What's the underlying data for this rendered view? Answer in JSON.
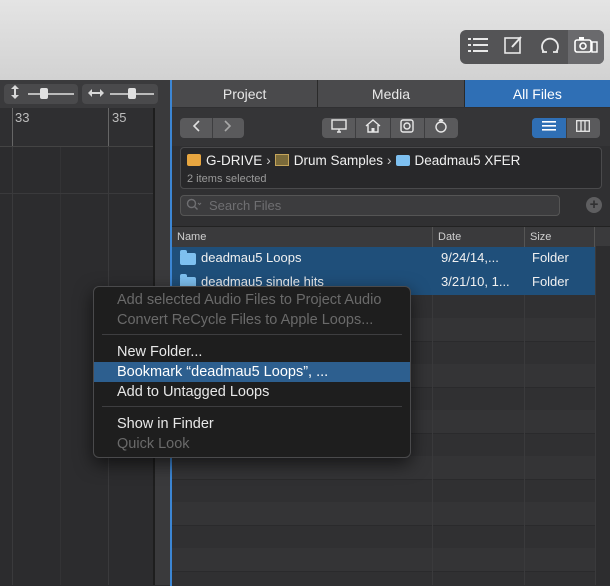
{
  "toolbar": {
    "tools": [
      "list-icon",
      "note-icon",
      "loop-icon",
      "browser-icon"
    ]
  },
  "ruler": {
    "marks": [
      "33",
      "35"
    ]
  },
  "browser": {
    "tabs": [
      {
        "label": "Project",
        "active": false
      },
      {
        "label": "Media",
        "active": false
      },
      {
        "label": "All Files",
        "active": true
      }
    ],
    "path": {
      "items": [
        {
          "label": "G-DRIVE",
          "icon": "drive-icon"
        },
        {
          "label": "Drum Samples",
          "icon": "film-folder-icon"
        },
        {
          "label": "Deadmau5 XFER",
          "icon": "folder-icon"
        }
      ],
      "status": "2 items selected"
    },
    "search": {
      "placeholder": "Search Files"
    },
    "columns": [
      "Name",
      "Date",
      "Size"
    ],
    "rows": [
      {
        "name": "deadmau5 Loops",
        "date": "9/24/14,...",
        "size": "Folder",
        "selected": true
      },
      {
        "name": "deadmau5 single hits",
        "date": "3/21/10, 1...",
        "size": "Folder",
        "selected": true
      }
    ]
  },
  "context_menu": {
    "items": [
      {
        "label": "Add selected Audio Files to Project Audio",
        "disabled": true
      },
      {
        "label": "Convert ReCycle Files to Apple Loops...",
        "disabled": true
      },
      {
        "label": "New Folder...",
        "disabled": false
      },
      {
        "label": "Bookmark “deadmau5 Loops”, ...",
        "disabled": false,
        "highlighted": true
      },
      {
        "label": "Add to Untagged Loops",
        "disabled": false
      },
      {
        "label": "Show in Finder",
        "disabled": false
      },
      {
        "label": "Quick Look",
        "disabled": true
      }
    ]
  },
  "colors": {
    "accent": "#2f6fb5",
    "selection": "#1f4f7a",
    "menu_highlight": "#2d5f8f"
  }
}
